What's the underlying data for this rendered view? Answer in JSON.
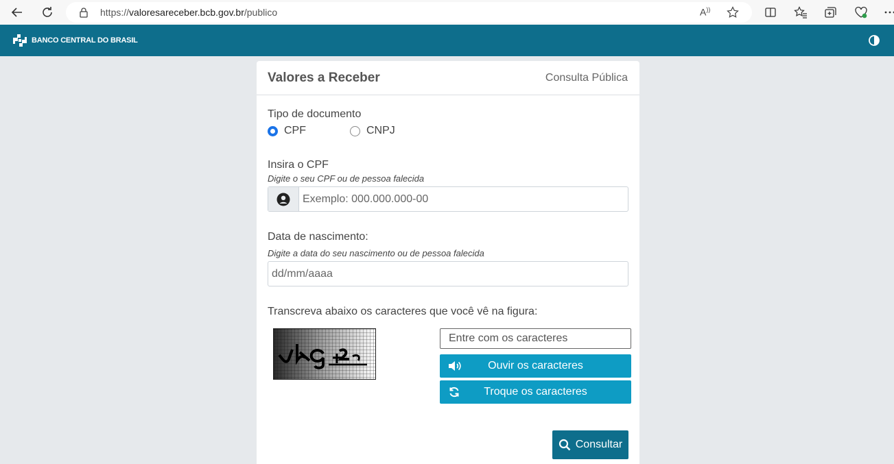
{
  "browser": {
    "url_scheme": "https://",
    "url_host": "valoresareceber.bcb.gov.br",
    "url_path": "/publico"
  },
  "site": {
    "logo_text": "BANCO CENTRAL DO BRASIL"
  },
  "card": {
    "title": "Valores a Receber",
    "subtitle": "Consulta Pública"
  },
  "form": {
    "doc_type_label": "Tipo de documento",
    "doc_types": [
      {
        "label": "CPF",
        "checked": true
      },
      {
        "label": "CNPJ",
        "checked": false
      }
    ],
    "cpf_label": "Insira o CPF",
    "cpf_hint": "Digite o seu CPF ou de pessoa falecida",
    "cpf_placeholder": "Exemplo: 000.000.000-00",
    "birth_label": "Data de nascimento:",
    "birth_hint": "Digite a data do seu nascimento ou de pessoa falecida",
    "birth_placeholder": "dd/mm/aaaa",
    "captcha_label": "Transcreva abaixo os caracteres que você vê na figura:",
    "captcha_placeholder": "Entre com os caracteres",
    "listen_button": "Ouvir os caracteres",
    "refresh_button": "Troque os caracteres",
    "submit_button": "Consultar"
  },
  "colors": {
    "header": "#0e6e8c",
    "button": "#0e9cc4",
    "submit": "#0e6e8c",
    "radio_checked": "#1a73e8"
  }
}
